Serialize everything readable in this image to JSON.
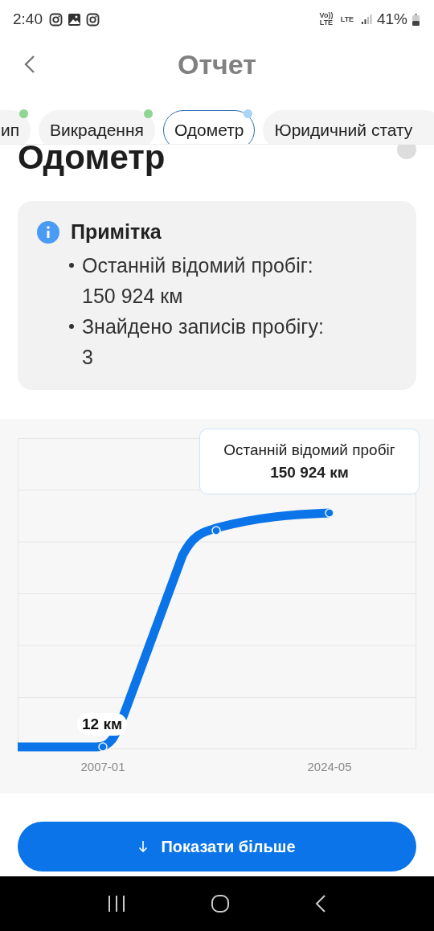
{
  "status_bar": {
    "time": "2:40",
    "network_labels": [
      "Vo)) LTE",
      "LTE"
    ],
    "battery": "41%"
  },
  "header": {
    "title": "Отчет"
  },
  "tabs": [
    {
      "label": "ип",
      "selected": false,
      "color": "#8fd694"
    },
    {
      "label": "Викрадення",
      "selected": false,
      "color": "#8fd694"
    },
    {
      "label": "Одометр",
      "selected": true,
      "color": "#a9d4f5"
    },
    {
      "label": "Юридичний стату",
      "selected": false
    }
  ],
  "section": {
    "title": "Одометр"
  },
  "note": {
    "title": "Примітка",
    "items": [
      "Останній відомий пробіг: 150 924 км",
      "Знайдено записів пробігу: 3"
    ]
  },
  "chart": {
    "tooltip_title": "Останній відомий пробіг",
    "tooltip_value": "150 924 км",
    "point_label": "12 км",
    "x_labels": [
      "2007-01",
      "2024-05"
    ]
  },
  "button": {
    "label": "Показати більше"
  }
}
